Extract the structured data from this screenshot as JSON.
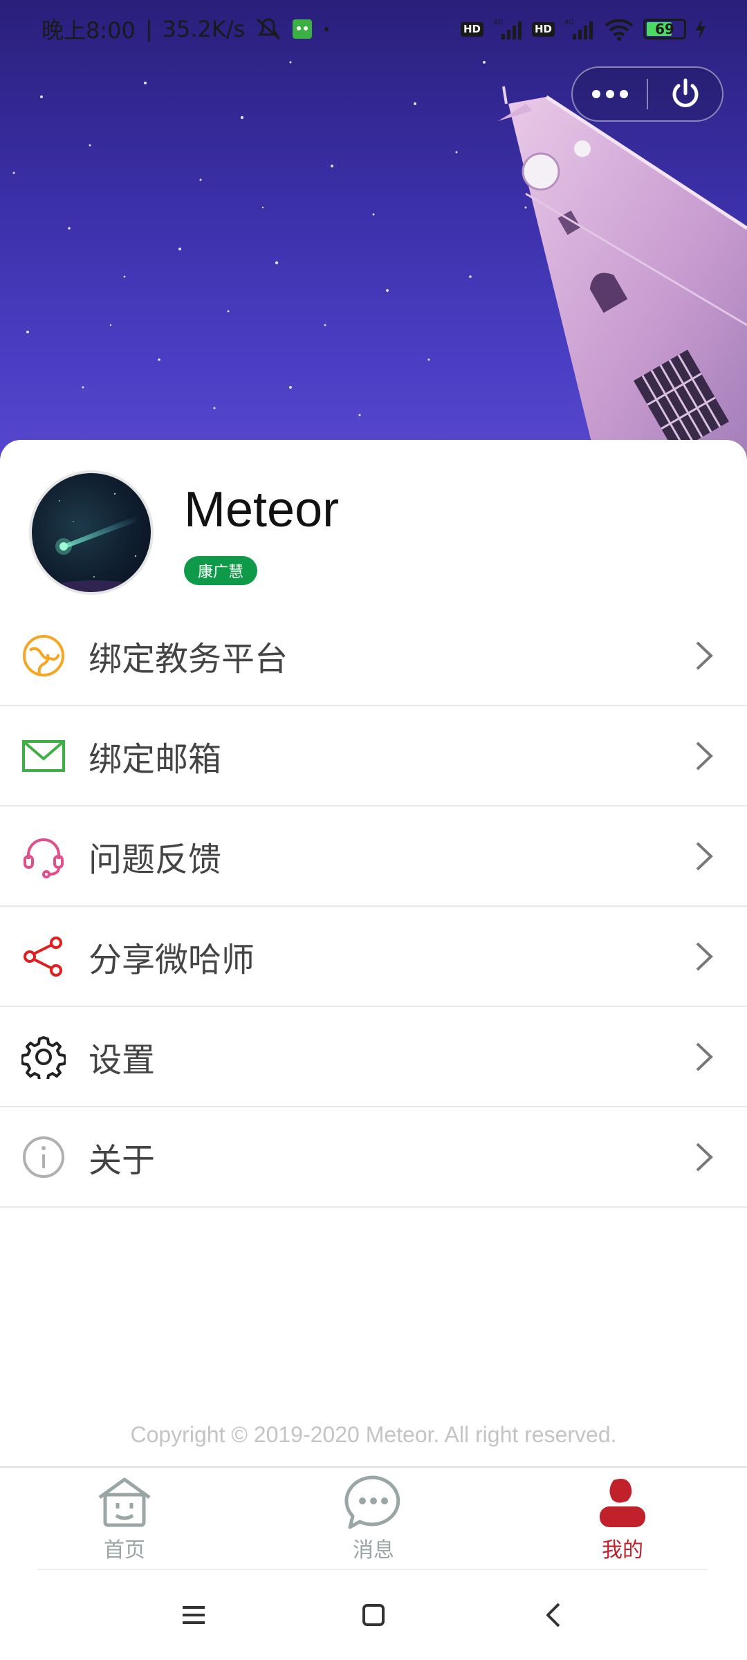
{
  "status_bar": {
    "time": "晚上8:00",
    "separator": "|",
    "net_speed": "35.2K/s",
    "sim1_type": "4G",
    "sim2_type": "4G",
    "hd_label": "HD",
    "battery_level": "69",
    "battery_fraction": 0.69
  },
  "capsule": {
    "more_icon": "more-dots-icon",
    "close_icon": "power-icon"
  },
  "profile": {
    "username": "Meteor",
    "badge": "康广慧",
    "badge_color": "#0f9a4a"
  },
  "menu": {
    "items": [
      {
        "label": "绑定教务平台",
        "icon": "globe-link-icon",
        "color": "#f5a623"
      },
      {
        "label": "绑定邮箱",
        "icon": "envelope-icon",
        "color": "#3cb043"
      },
      {
        "label": "问题反馈",
        "icon": "headset-icon",
        "color": "#e0508c"
      },
      {
        "label": "分享微哈师",
        "icon": "share-icon",
        "color": "#e02020"
      },
      {
        "label": "设置",
        "icon": "gear-icon",
        "color": "#222222"
      },
      {
        "label": "关于",
        "icon": "info-icon",
        "color": "#b0b0b0"
      }
    ]
  },
  "footer": {
    "copyright": "Copyright © 2019-2020 Meteor. All right reserved."
  },
  "tabbar": {
    "tabs": [
      {
        "label": "首页",
        "icon": "home-face-icon",
        "active": false
      },
      {
        "label": "消息",
        "icon": "chat-bubble-icon",
        "active": false
      },
      {
        "label": "我的",
        "icon": "user-icon",
        "active": true
      }
    ],
    "active_color": "#c0212b",
    "inactive_color": "#9aa5a5"
  },
  "system_nav": {
    "menu_icon": "menu-lines-icon",
    "home_icon": "square-home-icon",
    "back_icon": "back-chevron-icon"
  }
}
